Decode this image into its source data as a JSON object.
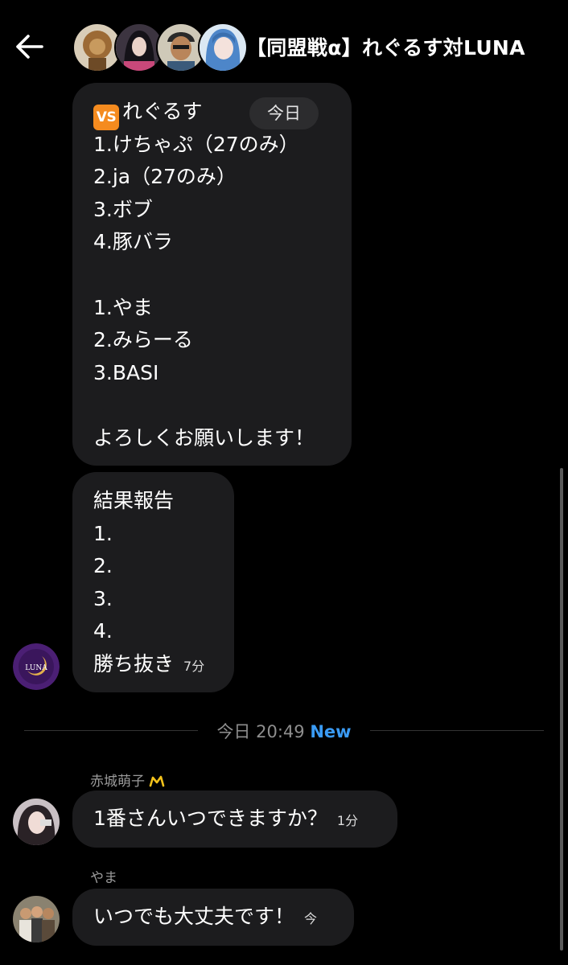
{
  "header": {
    "back_icon": "arrow-left-icon",
    "title": "【同盟戦α】れぐるす対LUNA"
  },
  "message1": {
    "first_line": "れぐるす",
    "badge_icon": "vs-button-emoji",
    "badge_text": "VS",
    "date_pill": "今日",
    "lines": [
      "1.けちゃぷ（27のみ）",
      "2.ja（27のみ）",
      "3.ボブ",
      "4.豚バラ",
      "",
      "1.やま",
      "2.みらーる",
      "3.BASI",
      "",
      "よろしくお願いします！"
    ]
  },
  "message2": {
    "lines": [
      "結果報告",
      "1.",
      "2.",
      "3.",
      "4."
    ],
    "last_line": "勝ち抜き",
    "time": "7分",
    "avatar_text": "LUNA"
  },
  "divider": {
    "text": "今日 20:49",
    "new_label": "New"
  },
  "message3": {
    "sender": "赤城萌子",
    "text": "1番さんいつできますか？",
    "time": "1分"
  },
  "message4": {
    "sender": "やま",
    "text": "いつでも大丈夫です！",
    "time": "今"
  },
  "colors": {
    "background": "#000000",
    "bubble": "#1c1c1e",
    "new_accent": "#3a9bf5",
    "vs_badge": "#f58b1f"
  }
}
